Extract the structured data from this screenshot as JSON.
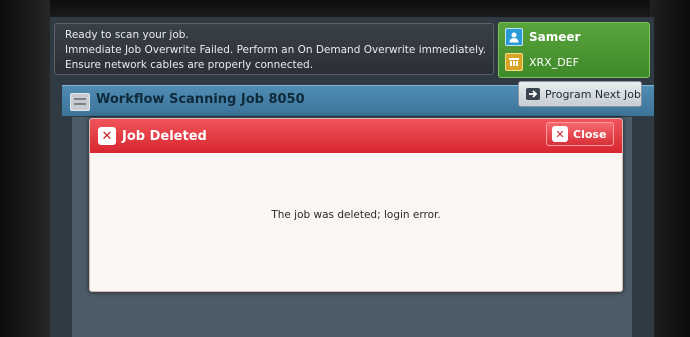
{
  "status_bar": {
    "line1": "Ready to scan your job.",
    "line2": "Immediate Job Overwrite Failed.  Perform an On Demand Overwrite immediately.",
    "line3": "Ensure network cables are properly connected."
  },
  "user_panel": {
    "user_name": "Sameer",
    "user_icon": "person-icon",
    "device_name": "XRX_DEF",
    "device_icon": "device-icon",
    "accent_color": "#4f9a34"
  },
  "header": {
    "title": "Workflow Scanning Job 8050",
    "program_next_job_label": "Program Next Job"
  },
  "dialog": {
    "title": "Job Deleted",
    "close_label": "Close",
    "message": "The job was deleted; login error.",
    "header_color": "#dc2d35"
  }
}
